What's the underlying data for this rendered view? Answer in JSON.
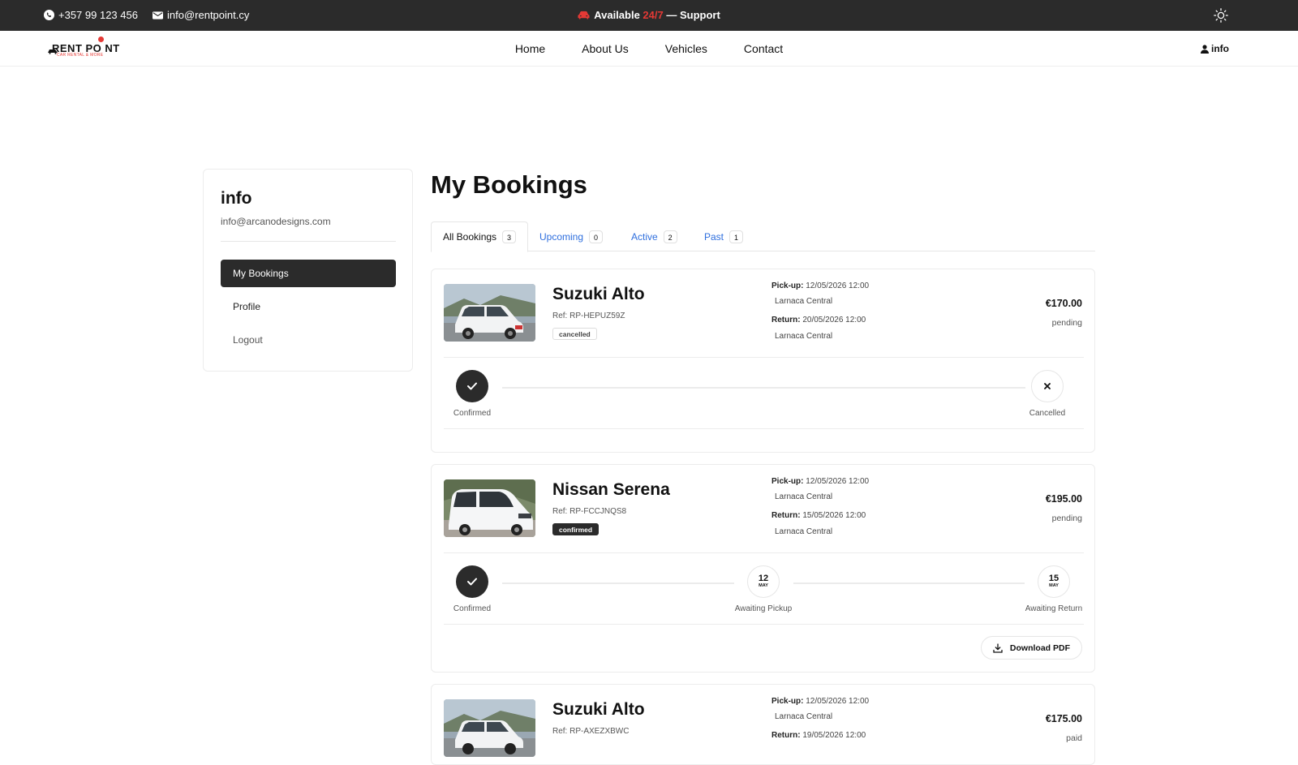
{
  "topbar": {
    "phone": "+357 99 123 456",
    "email": "info@rentpoint.cy",
    "availability_prefix": "Available ",
    "availability_accent": "24/7",
    "availability_suffix": " — Support",
    "accent_color": "#e53935"
  },
  "nav": {
    "logo_text": "RENT PO NT",
    "logo_tagline": "CAR RENTAL & MORE",
    "links": [
      "Home",
      "About Us",
      "Vehicles",
      "Contact"
    ],
    "user_label": "info"
  },
  "sidebar": {
    "name": "info",
    "email": "info@arcanodesigns.com",
    "items": [
      {
        "label": "My Bookings",
        "active": true
      },
      {
        "label": "Profile",
        "active": false
      },
      {
        "label": "Logout",
        "active": false
      }
    ]
  },
  "main": {
    "title": "My Bookings",
    "tabs": [
      {
        "label": "All Bookings",
        "count": "3",
        "active": true
      },
      {
        "label": "Upcoming",
        "count": "0",
        "active": false
      },
      {
        "label": "Active",
        "count": "2",
        "active": false
      },
      {
        "label": "Past",
        "count": "1",
        "active": false
      }
    ]
  },
  "bookings": [
    {
      "car": "Suzuki Alto",
      "ref": "Ref: RP-HEPUZ59Z",
      "status": "cancelled",
      "pickup_label": "Pick-up:",
      "pickup_date": "12/05/2026 12:00",
      "pickup_location": "Larnaca Central",
      "return_label": "Return:",
      "return_date": "20/05/2026 12:00",
      "return_location": "Larnaca Central",
      "price": "€170.00",
      "payment": "pending",
      "steps": [
        {
          "label": "Confirmed",
          "state": "done",
          "icon": "check-icon"
        },
        {
          "label": "Cancelled",
          "state": "open",
          "icon": "x-icon"
        }
      ]
    },
    {
      "car": "Nissan Serena",
      "ref": "Ref: RP-FCCJNQS8",
      "status": "confirmed",
      "pickup_label": "Pick-up:",
      "pickup_date": "12/05/2026 12:00",
      "pickup_location": "Larnaca Central",
      "return_label": "Return:",
      "return_date": "15/05/2026 12:00",
      "return_location": "Larnaca Central",
      "price": "€195.00",
      "payment": "pending",
      "steps": [
        {
          "label": "Confirmed",
          "state": "done",
          "icon": "check-icon"
        },
        {
          "label": "Awaiting Pickup",
          "state": "open",
          "day": "12",
          "month": "MAY"
        },
        {
          "label": "Awaiting Return",
          "state": "open",
          "day": "15",
          "month": "MAY"
        }
      ],
      "download_label": "Download PDF"
    },
    {
      "car": "Suzuki Alto",
      "ref": "Ref: RP-AXEZXBWC",
      "pickup_label": "Pick-up:",
      "pickup_date": "12/05/2026 12:00",
      "pickup_location": "Larnaca Central",
      "return_label": "Return:",
      "return_date": "19/05/2026 12:00",
      "price": "€175.00",
      "payment": "paid"
    }
  ]
}
